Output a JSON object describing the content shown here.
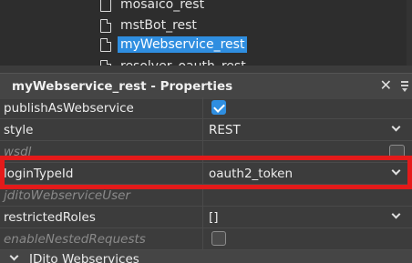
{
  "tree": {
    "items": [
      {
        "label": "mosaico_rest",
        "selected": false
      },
      {
        "label": "mstBot_rest",
        "selected": false
      },
      {
        "label": "myWebservice_rest",
        "selected": true
      },
      {
        "label": "resolver_oauth_rest",
        "selected": false
      }
    ]
  },
  "panel": {
    "title": "myWebservice_rest - Properties",
    "close_icon": "close-icon",
    "menu_icon": "view-menu-icon"
  },
  "properties": [
    {
      "name": "publishAsWebservice",
      "value": "",
      "editor": "checkbox-checked",
      "italic": false
    },
    {
      "name": "style",
      "value": "REST",
      "editor": "dropdown",
      "italic": false
    },
    {
      "name": "wsdl",
      "value": "",
      "editor": "edit-box",
      "italic": true
    },
    {
      "name": "loginTypeId",
      "value": "oauth2_token",
      "editor": "dropdown",
      "italic": false
    },
    {
      "name": "jditoWebserviceUser",
      "value": "",
      "editor": "none",
      "italic": true
    },
    {
      "name": "restrictedRoles",
      "value": "[]",
      "editor": "dropdown",
      "italic": false
    },
    {
      "name": "enableNestedRequests",
      "value": "",
      "editor": "checkbox-empty",
      "italic": true
    }
  ],
  "section": {
    "label": "JDito Webservices"
  },
  "colors": {
    "selection": "#2f8ee0",
    "highlight_frame": "#e41a1a",
    "background": "#3c3c3c"
  }
}
